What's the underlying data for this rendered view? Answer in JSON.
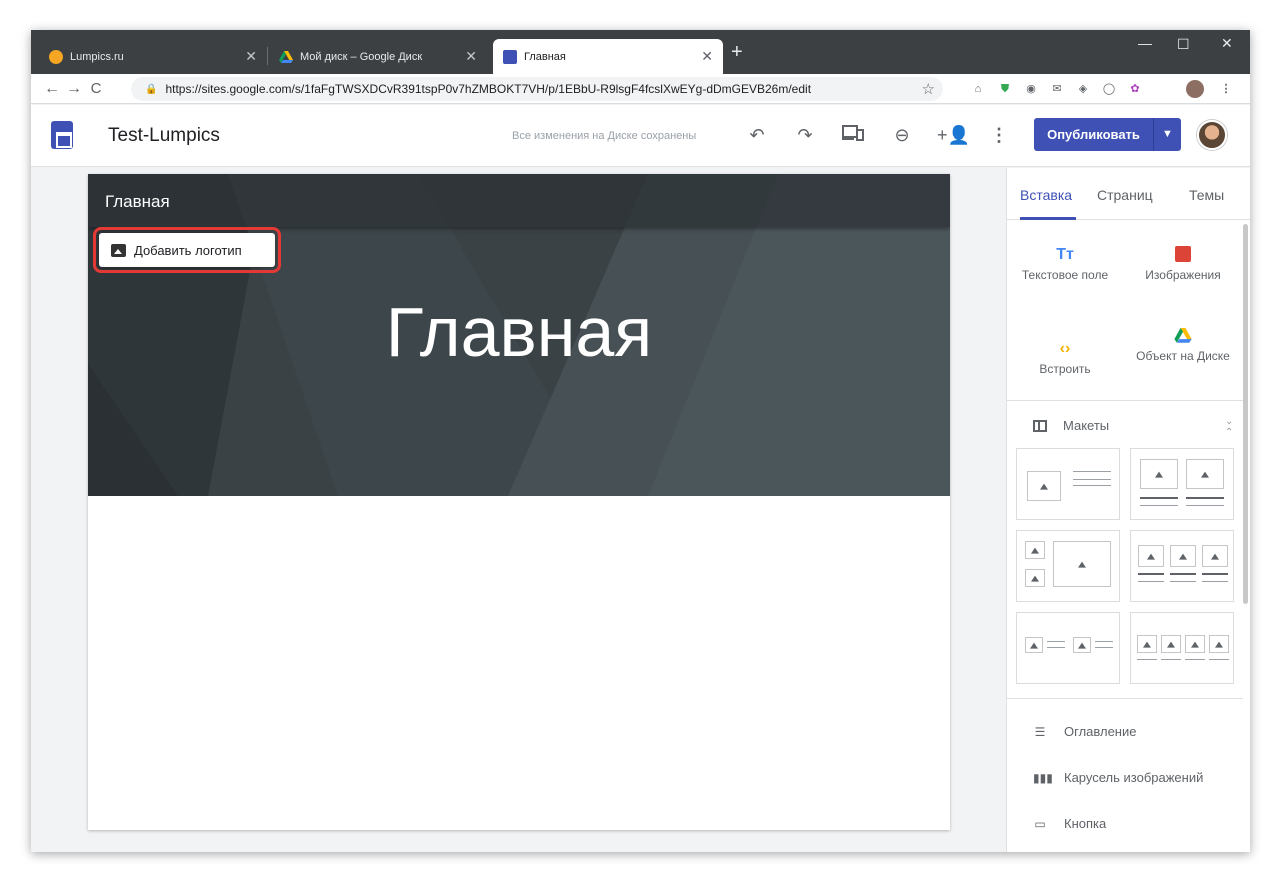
{
  "browser": {
    "tabs": [
      {
        "title": "Lumpics.ru",
        "active": false
      },
      {
        "title": "Мой диск – Google Диск",
        "active": false
      },
      {
        "title": "Главная",
        "active": true
      }
    ],
    "url": "https://sites.google.com/s/1faFgTWSXDCvR391tspP0v7hZMBOKT7VH/p/1EBbU-R9lsgF4fcslXwEYg-dDmGEVB26m/edit"
  },
  "app": {
    "site_title": "Test-Lumpics",
    "save_status": "Все изменения на Диске сохранены",
    "publish_label": "Опубликовать",
    "brand_color": "#3f51b5"
  },
  "page": {
    "nav_title": "Главная",
    "add_logo_label": "Добавить логотип",
    "hero_title": "Главная"
  },
  "panel": {
    "tabs": [
      "Вставка",
      "Страниц",
      "Темы"
    ],
    "tools": [
      "Текстовое поле",
      "Изображения",
      "Встроить",
      "Объект на Диске"
    ],
    "layouts_label": "Макеты",
    "components": [
      "Оглавление",
      "Карусель изображений",
      "Кнопка"
    ]
  }
}
